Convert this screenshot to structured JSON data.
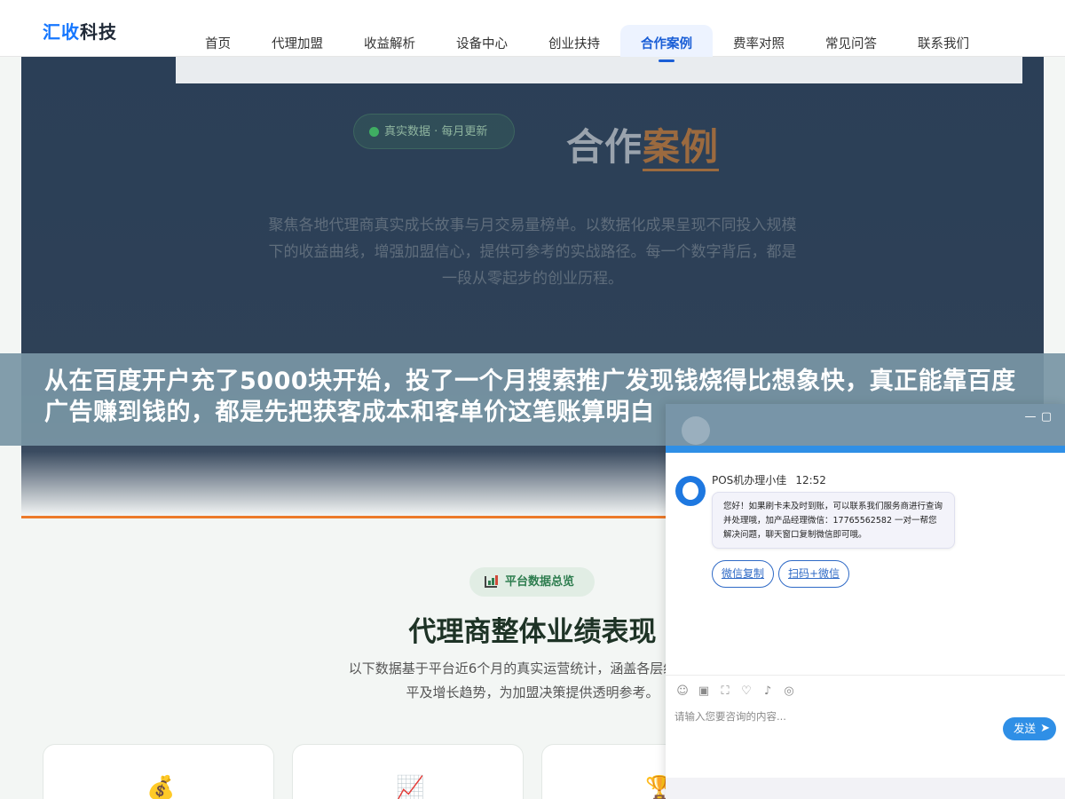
{
  "logo": {
    "brand_accent": "汇收",
    "brand_rest": "科技"
  },
  "nav": {
    "items": [
      {
        "label": "首页",
        "active": false
      },
      {
        "label": "代理加盟",
        "active": false
      },
      {
        "label": "收益解析",
        "active": false
      },
      {
        "label": "设备中心",
        "active": false
      },
      {
        "label": "创业扶持",
        "active": false
      },
      {
        "label": "合作案例",
        "active": true
      },
      {
        "label": "费率对照",
        "active": false
      },
      {
        "label": "常见问答",
        "active": false
      },
      {
        "label": "联系我们",
        "active": false
      }
    ]
  },
  "hero": {
    "badge": "真实数据 · 每月更新",
    "title_plain": "合作",
    "title_accent": "案例",
    "description": "聚焦各地代理商真实成长故事与月交易量榜单。以数据化成果呈现不同投入规模下的收益曲线，增强加盟信心，提供可参考的实战路径。每一个数字背后，都是一段从零起步的创业历程。"
  },
  "banner": {
    "text": "从在百度开户充了5000块开始，投了一个月搜索推广发现钱烧得比想象快，真正能靠百度广告赚到钱的，都是先把获客成本和客单价这笔账算明白"
  },
  "overview": {
    "pill": "平台数据总览",
    "title": "代理商整体业绩表现",
    "description": "以下数据基于平台近6个月的真实运营统计，涵盖各层级代理商",
    "description_line2": "平及增长趋势，为加盟决策提供透明参考。",
    "cards": [
      {
        "icon": "money-bag-icon",
        "glyph": "💰"
      },
      {
        "icon": "trend-chart-icon",
        "glyph": "📈"
      },
      {
        "icon": "trophy-icon",
        "glyph": "🏆"
      }
    ]
  },
  "chat": {
    "minimize_label": "—",
    "maximize_label": "▢",
    "agent_name": "POS机办理小佳",
    "time": "12:52",
    "message": "您好！如果刷卡未及时到账，可以联系我们服务商进行查询并处理哦，加产品经理微信：17765562582 一对一帮您解决问题，聊天窗口复制微信即可哦。",
    "quick_replies": [
      "微信复制",
      "扫码+微信"
    ],
    "input_placeholder": "请输入您要咨询的内容...",
    "send_label": "发送",
    "tools": [
      "emoji-icon",
      "image-icon",
      "screenshot-icon",
      "shield-icon",
      "sound-icon",
      "wechat-icon"
    ]
  },
  "colors": {
    "primary_blue": "#1677ff",
    "hero_bg": "#2b3f57",
    "accent_orange": "#ec7a2a",
    "chat_blue": "#2f8fe6"
  }
}
